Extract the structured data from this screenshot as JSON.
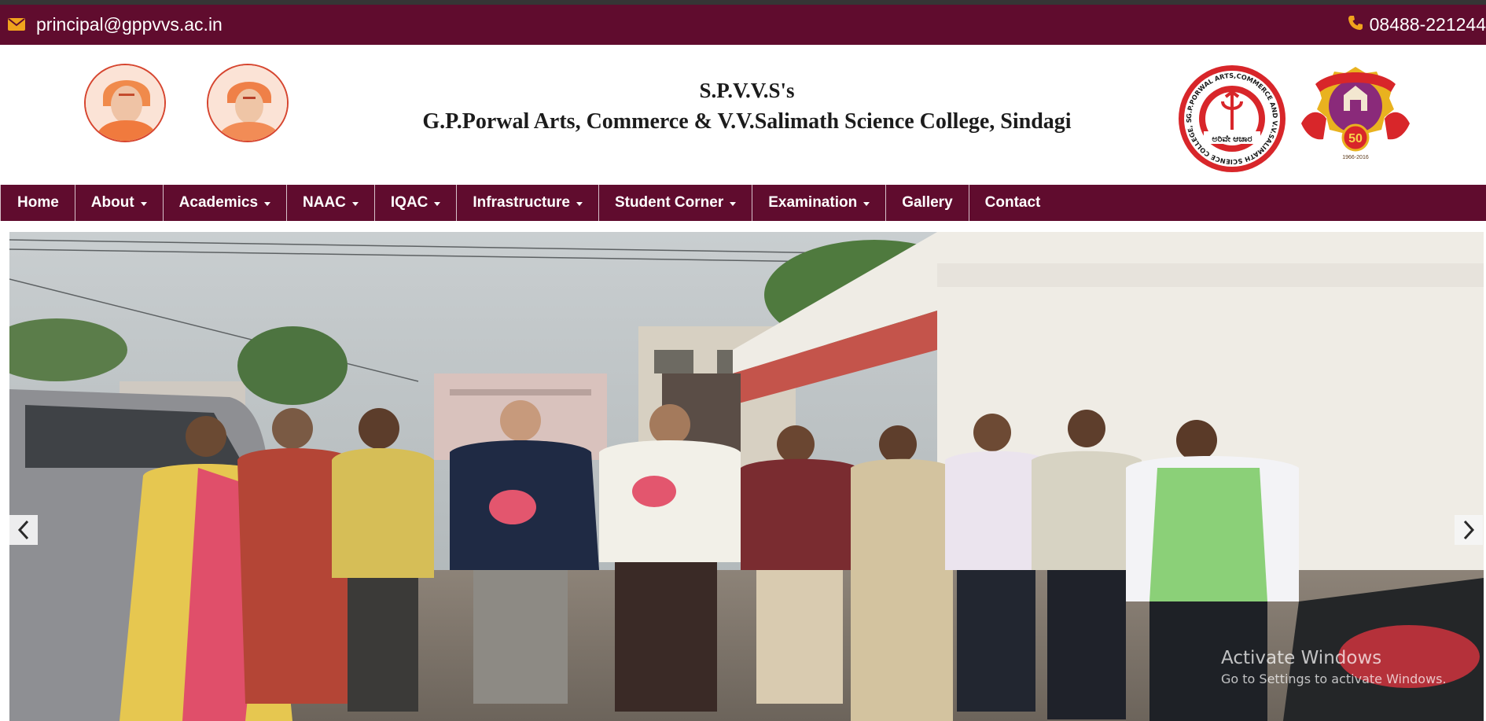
{
  "topbar": {
    "email": "principal@gppvvs.ac.in",
    "email_icon": "envelope-icon",
    "phone": "08488-221244",
    "phone_icon": "phone-icon"
  },
  "header": {
    "society": "S.P.V.V.S's",
    "college": "G.P.Porwal Arts, Commerce & V.V.Salimath Science College, Sindagi",
    "seal_ring_text": "G.P.PORWAL ARTS,COMMERCE AND V.V.SALIMATH SCIENCE COLLEGE, SINDGI",
    "seal_center_text": "ಅರಿವೇ ಆಚಾರ",
    "badge_number": "50",
    "badge_years": "1966-2016"
  },
  "nav": {
    "items": [
      {
        "label": "Home",
        "dropdown": false
      },
      {
        "label": "About",
        "dropdown": true
      },
      {
        "label": "Academics",
        "dropdown": true
      },
      {
        "label": "NAAC",
        "dropdown": true
      },
      {
        "label": "IQAC",
        "dropdown": true
      },
      {
        "label": "Infrastructure",
        "dropdown": true
      },
      {
        "label": "Student Corner",
        "dropdown": true
      },
      {
        "label": "Examination",
        "dropdown": true
      },
      {
        "label": "Gallery",
        "dropdown": false
      },
      {
        "label": "Contact",
        "dropdown": false
      }
    ]
  },
  "carousel": {
    "prev_icon": "chevron-left-icon",
    "next_icon": "chevron-right-icon"
  },
  "watermark": {
    "title": "Activate Windows",
    "subtitle": "Go to Settings to activate Windows."
  },
  "colors": {
    "brand_maroon": "#600c2e",
    "accent_orange": "#f0a31d",
    "seal_red": "#d8262a"
  }
}
